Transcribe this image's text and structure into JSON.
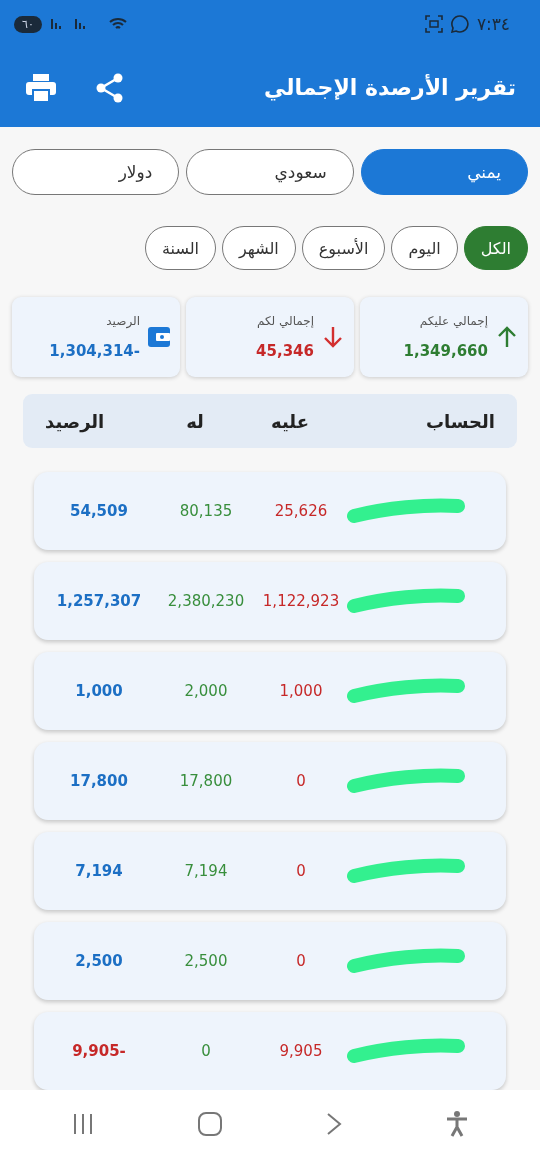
{
  "status_bar": {
    "time": "٧:٣٤",
    "battery": "٦٠"
  },
  "app_bar": {
    "title": "تقرير الأرصدة الإجمالي"
  },
  "currencies": [
    {
      "label": "يمني",
      "selected": true
    },
    {
      "label": "سعودي",
      "selected": false
    },
    {
      "label": "دولار",
      "selected": false
    }
  ],
  "periods": [
    {
      "label": "الكل",
      "selected": true
    },
    {
      "label": "اليوم",
      "selected": false
    },
    {
      "label": "الأسبوع",
      "selected": false
    },
    {
      "label": "الشهر",
      "selected": false
    },
    {
      "label": "السنة",
      "selected": false
    }
  ],
  "summary": [
    {
      "kind": "up",
      "label": "إجمالي عليكم",
      "value": "1,349,660"
    },
    {
      "kind": "down",
      "label": "إجمالي لكم",
      "value": "45,346"
    },
    {
      "kind": "wallet",
      "label": "الرصيد",
      "value": "1,304,314-"
    }
  ],
  "table": {
    "columns": [
      "الحساب",
      "عليه",
      "له",
      "الرصيد"
    ],
    "rows": [
      {
        "debit": "25,626",
        "credit": "80,135",
        "balance": "54,509",
        "negative": false
      },
      {
        "debit": "1,122,923",
        "credit": "2,380,230",
        "balance": "1,257,307",
        "negative": false
      },
      {
        "debit": "1,000",
        "credit": "2,000",
        "balance": "1,000",
        "negative": false
      },
      {
        "debit": "0",
        "credit": "17,800",
        "balance": "17,800",
        "negative": false
      },
      {
        "debit": "0",
        "credit": "7,194",
        "balance": "7,194",
        "negative": false
      },
      {
        "debit": "0",
        "credit": "2,500",
        "balance": "2,500",
        "negative": false
      },
      {
        "debit": "9,905",
        "credit": "0",
        "balance": "9,905-",
        "negative": true
      }
    ]
  }
}
